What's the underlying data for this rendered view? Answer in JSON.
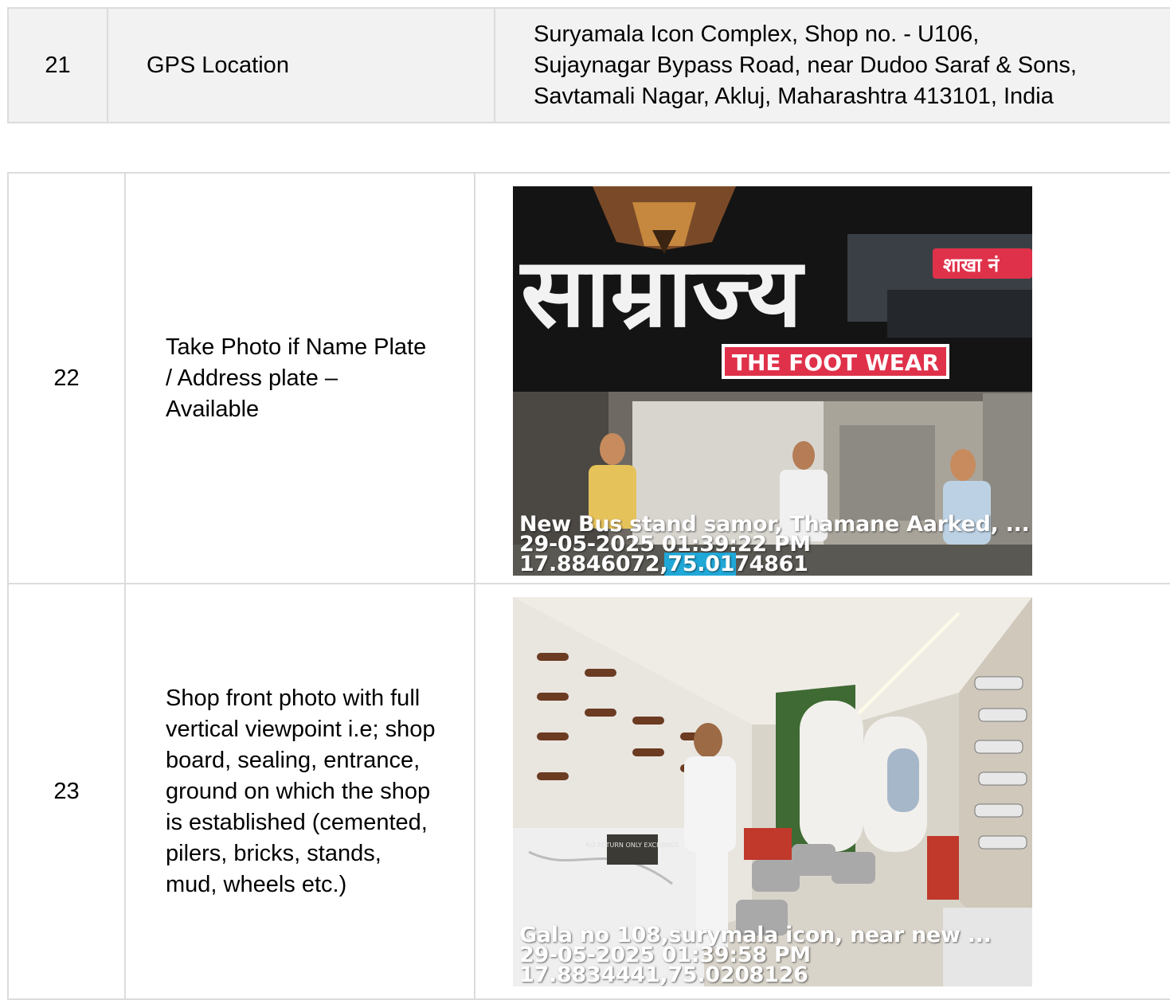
{
  "rows": [
    {
      "num": "21",
      "label": "GPS Location",
      "value_lines": [
        "Suryamala Icon Complex, Shop no. - U106,",
        "Sujaynagar Bypass Road, near Dudoo Saraf & Sons,",
        "Savtamali Nagar, Akluj, Maharashtra 413101, India"
      ]
    },
    {
      "num": "22",
      "label_lines": [
        "Take Photo if Name Plate",
        "/ Address plate –",
        "Available"
      ],
      "photo": {
        "sign_text": "THE FOOT WEAR",
        "sign_devanagari": "साम्राज्य",
        "branch_tag": "शाखा नं",
        "stamp_lines": [
          "New Bus stand samor, Thamane Aarked, ...",
          "29-05-2025 01:39:22 PM",
          "17.8846072,75.0174861"
        ]
      }
    },
    {
      "num": "23",
      "label_lines": [
        "Shop front photo with full",
        "vertical viewpoint i.e; shop",
        "board, sealing, entrance,",
        "ground on which the shop",
        "is established (cemented,",
        "pilers, bricks, stands,",
        "mud, wheels etc.)"
      ],
      "photo": {
        "counter_sign": "NO RETURN ONLY EXCHANGE",
        "stamp_lines": [
          "Gala no 108,surymala icon, near new ...",
          "29-05-2025 01:39:58 PM",
          "17.8834441,75.0208126"
        ]
      }
    }
  ],
  "colors": {
    "row21_bg": "#f2f2f2",
    "border": "#dcdcdc",
    "sign_red": "#e0314a"
  }
}
